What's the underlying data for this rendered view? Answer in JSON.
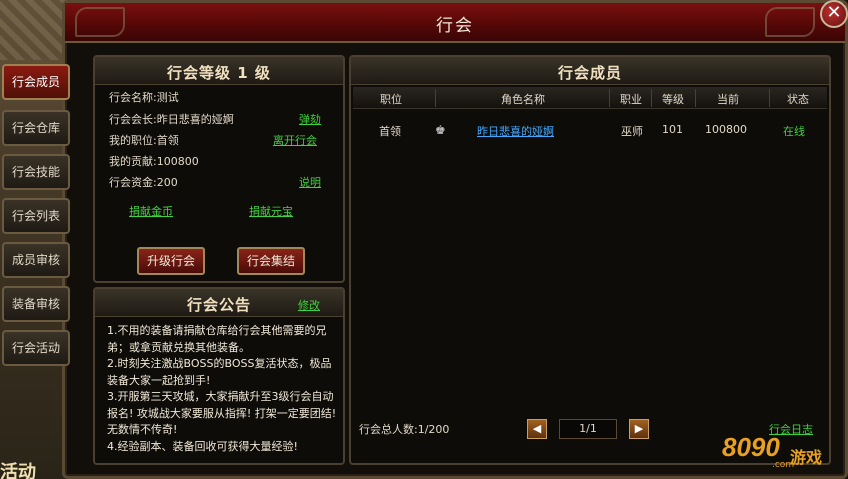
{
  "background": {
    "bottom_text": "活动"
  },
  "window": {
    "title": "行会",
    "close_label": "✕"
  },
  "side_tabs": [
    {
      "label": "行会成员",
      "active": true
    },
    {
      "label": "行会仓库"
    },
    {
      "label": "行会技能"
    },
    {
      "label": "行会列表"
    },
    {
      "label": "成员审核"
    },
    {
      "label": "装备审核"
    },
    {
      "label": "行会活动"
    }
  ],
  "guild_info": {
    "level_title": "行会等级  1  级",
    "name_label": "行会名称:",
    "name_value": "测试",
    "leader_label": "行会会长:",
    "leader_value": "昨日悲喜的娅婀",
    "impeach_link": "弹劾",
    "position_label": "我的职位:",
    "position_value": "首领",
    "leave_link": "离开行会",
    "contrib_label": "我的贡献:",
    "contrib_value": "100800",
    "funds_label": "行会资金:",
    "funds_value": "200",
    "explain_link": "说明",
    "donate_gold_link": "捐献金币",
    "donate_yuanbao_link": "捐献元宝",
    "upgrade_button": "升级行会",
    "gather_button": "行会集结"
  },
  "notice": {
    "title": "行会公告",
    "edit_link": "修改",
    "lines": [
      "1.不用的装备请捐献仓库给行会其他需要的兄弟；或拿贡献兑换其他装备。",
      "2.时刻关注激战BOSS的BOSS复活状态，极品装备大家一起抢到手!",
      "3.开服第三天攻城，大家捐献升至3级行会自动报名! 攻城战大家要服从指挥! 打架一定要团结! 无数情不传奇!",
      "4.经验副本、装备回收可获得大量经验!"
    ]
  },
  "members": {
    "title": "行会成员",
    "columns": [
      "职位",
      "角色名称",
      "职业",
      "等级",
      "当前",
      "状态"
    ],
    "rows": [
      {
        "position": "首领",
        "name": "昨日悲喜的娅婀",
        "class": "巫师",
        "level": "101",
        "current": "100800",
        "status": "在线"
      }
    ],
    "total_label": "行会总人数:1/200",
    "page": "1/1",
    "prev_label": "◀",
    "next_label": "▶",
    "log_link": "行会日志"
  },
  "watermark": {
    "brand": "8090",
    "game": "游戏",
    "domain": ".com"
  },
  "colors": {
    "link_green": "#40d040",
    "link_blue": "#40a8ff",
    "title_red": "#7a1010",
    "status_online": "#40d040"
  }
}
